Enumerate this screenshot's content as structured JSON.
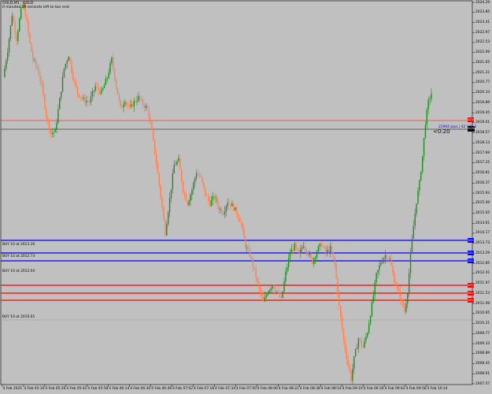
{
  "window": {
    "title": "GOLD,M1 : GOLD",
    "status": "0 minutes 19 seconds left to bar end"
  },
  "annotation": {
    "pips_text": "21904 pips | 42 185.2",
    "countdown": "<0:20"
  },
  "buy_labels": [
    "BUY 10 at 2013.30",
    "BUY 10 at 2012.73",
    "BUY 10 at 2012.04",
    "BUY 10 at 2010.01"
  ],
  "price_axis": [
    "2024.29",
    "2023.85",
    "2023.41",
    "2022.97",
    "2022.53",
    "2022.09",
    "2021.65",
    "2021.21",
    "2020.77",
    "2020.33",
    "2019.89",
    "2019.45",
    "2019.01",
    "2018.57",
    "2018.13",
    "2017.69",
    "2017.25",
    "2016.81",
    "2016.37",
    "2015.93",
    "2015.49",
    "2015.05",
    "2014.61",
    "2014.17",
    "2013.73",
    "2013.29",
    "2012.85",
    "2012.41",
    "2011.97",
    "2011.53",
    "2011.09",
    "2010.65",
    "2010.21",
    "2009.77",
    "2009.33",
    "2008.89",
    "2008.45",
    "2008.01",
    "2007.57"
  ],
  "level_tags": {
    "red_top": "2020.55",
    "current": "2020.28",
    "blue1": "2013.50",
    "blue2": "2013.08",
    "blue3": "2012.81",
    "red1": "2011.72",
    "red2": "2011.49",
    "red3": "2011.26"
  },
  "time_axis": [
    "4 Feb 2025",
    "4 Feb 05:10",
    "4 Feb 05:26",
    "4 Feb 05:42",
    "4 Feb 05:58",
    "4 Feb 06:14",
    "4 Feb 06:30",
    "4 Feb 06:46",
    "4 Feb 07:02",
    "4 Feb 07:18",
    "4 Feb 07:34",
    "4 Feb 07:50",
    "4 Feb 08:06",
    "4 Feb 08:22",
    "4 Feb 08:38",
    "4 Feb 08:54",
    "4 Feb 09:10",
    "4 Feb 09:26",
    "4 Feb 09:42",
    "4 Feb 09:58",
    "4 Feb 10:14"
  ],
  "colors": {
    "background": "#c0c0c0",
    "bull": "#228b22",
    "bear": "#ff7f50",
    "buy_line": "#0000ff",
    "stop_line": "#ff0000",
    "current_line": "#000000"
  },
  "chart_data": {
    "type": "candlestick",
    "ylim": [
      2007.35,
      2024.4
    ],
    "close_path": [
      [
        0,
        2021.0
      ],
      [
        3,
        2022.2
      ],
      [
        6,
        2023.8
      ],
      [
        9,
        2022.7
      ],
      [
        12,
        2024.0
      ],
      [
        14,
        2024.2
      ],
      [
        16,
        2023.4
      ],
      [
        18,
        2022.5
      ],
      [
        20,
        2021.8
      ],
      [
        23,
        2021.4
      ],
      [
        26,
        2020.6
      ],
      [
        29,
        2019.3
      ],
      [
        32,
        2018.5
      ],
      [
        35,
        2018.6
      ],
      [
        38,
        2020.0
      ],
      [
        41,
        2021.4
      ],
      [
        44,
        2022.0
      ],
      [
        47,
        2021.0
      ],
      [
        50,
        2020.3
      ],
      [
        54,
        2020.0
      ],
      [
        58,
        2019.9
      ],
      [
        62,
        2020.6
      ],
      [
        66,
        2020.3
      ],
      [
        70,
        2021.0
      ],
      [
        73,
        2021.8
      ],
      [
        76,
        2020.6
      ],
      [
        79,
        2019.6
      ],
      [
        82,
        2020.0
      ],
      [
        85,
        2019.6
      ],
      [
        88,
        2019.9
      ],
      [
        91,
        2020.1
      ],
      [
        94,
        2019.8
      ],
      [
        97,
        2019.6
      ],
      [
        100,
        2018.6
      ],
      [
        103,
        2017.2
      ],
      [
        106,
        2015.7
      ],
      [
        109,
        2014.1
      ],
      [
        112,
        2015.6
      ],
      [
        115,
        2017.1
      ],
      [
        118,
        2017.3
      ],
      [
        121,
        2016.0
      ],
      [
        124,
        2015.4
      ],
      [
        127,
        2016.0
      ],
      [
        130,
        2016.8
      ],
      [
        133,
        2016.5
      ],
      [
        136,
        2015.8
      ],
      [
        139,
        2015.4
      ],
      [
        142,
        2015.7
      ],
      [
        145,
        2015.2
      ],
      [
        148,
        2015.0
      ],
      [
        151,
        2015.5
      ],
      [
        154,
        2015.3
      ],
      [
        157,
        2015.0
      ],
      [
        160,
        2014.5
      ],
      [
        163,
        2013.5
      ],
      [
        166,
        2013.1
      ],
      [
        169,
        2012.4
      ],
      [
        172,
        2011.6
      ],
      [
        175,
        2011.0
      ],
      [
        178,
        2011.5
      ],
      [
        181,
        2011.8
      ],
      [
        184,
        2011.5
      ],
      [
        187,
        2011.1
      ],
      [
        190,
        2012.3
      ],
      [
        193,
        2013.2
      ],
      [
        196,
        2013.5
      ],
      [
        199,
        2013.1
      ],
      [
        202,
        2013.6
      ],
      [
        205,
        2013.2
      ],
      [
        208,
        2012.8
      ],
      [
        211,
        2013.3
      ],
      [
        214,
        2013.6
      ],
      [
        217,
        2013.2
      ],
      [
        220,
        2013.4
      ],
      [
        223,
        2012.7
      ],
      [
        226,
        2010.8
      ],
      [
        229,
        2009.3
      ],
      [
        232,
        2008.2
      ],
      [
        234,
        2007.6
      ],
      [
        236,
        2008.5
      ],
      [
        239,
        2009.4
      ],
      [
        242,
        2009.0
      ],
      [
        245,
        2009.7
      ],
      [
        248,
        2010.9
      ],
      [
        251,
        2012.2
      ],
      [
        254,
        2012.8
      ],
      [
        257,
        2013.1
      ],
      [
        260,
        2012.9
      ],
      [
        263,
        2012.0
      ],
      [
        266,
        2011.4
      ],
      [
        268,
        2011.0
      ],
      [
        270,
        2010.6
      ],
      [
        272,
        2011.5
      ],
      [
        274,
        2013.1
      ],
      [
        276,
        2014.4
      ],
      [
        278,
        2015.5
      ],
      [
        280,
        2016.3
      ],
      [
        282,
        2017.5
      ],
      [
        284,
        2019.0
      ],
      [
        286,
        2019.9
      ],
      [
        288,
        2020.3
      ]
    ],
    "buy_levels": [
      2013.3,
      2012.73,
      2012.04,
      2010.01
    ]
  }
}
